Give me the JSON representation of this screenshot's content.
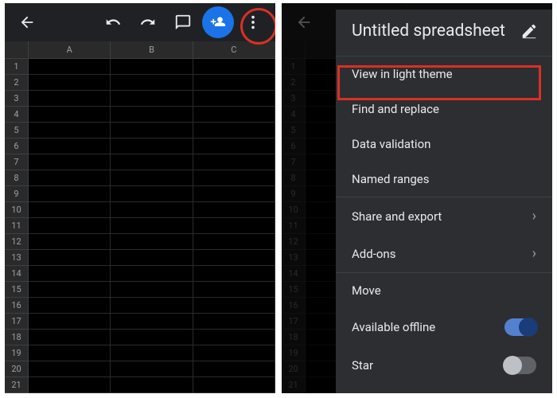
{
  "columns": [
    "A",
    "B",
    "C"
  ],
  "row_count": 21,
  "menu": {
    "title": "Untitled spreadsheet",
    "items": {
      "view_light": "View in light theme",
      "find_replace": "Find and replace",
      "data_validation": "Data validation",
      "named_ranges": "Named ranges",
      "share_export": "Share and export",
      "add_ons": "Add-ons",
      "move": "Move",
      "available_offline": "Available offline",
      "star": "Star"
    },
    "toggles": {
      "available_offline": true,
      "star": false
    }
  }
}
